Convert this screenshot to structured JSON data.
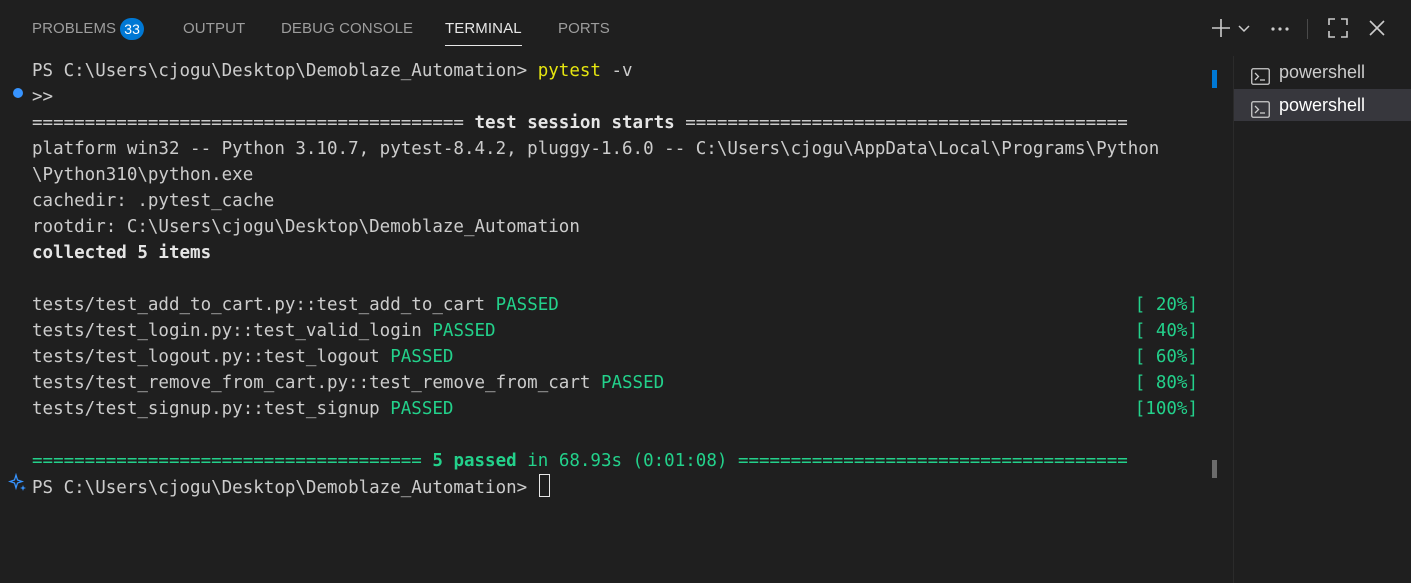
{
  "tabs": {
    "problems": "PROBLEMS",
    "problems_count": "33",
    "output": "OUTPUT",
    "debug_console": "DEBUG CONSOLE",
    "terminal": "TERMINAL",
    "ports": "PORTS"
  },
  "terminal": {
    "l1_prompt": "PS C:\\Users\\cjogu\\Desktop\\Demoblaze_Automation> ",
    "l1_cmd": "pytest",
    "l1_arg": " -v",
    "l2": ">>",
    "l3_left": "========================================= ",
    "l3_mid": "test session starts",
    "l3_right": " ==========================================",
    "l4": "platform win32 -- Python 3.10.7, pytest-8.4.2, pluggy-1.6.0 -- C:\\Users\\cjogu\\AppData\\Local\\Programs\\Python",
    "l5": "\\Python310\\python.exe",
    "l6": "cachedir: .pytest_cache",
    "l7": "rootdir: C:\\Users\\cjogu\\Desktop\\Demoblaze_Automation",
    "l8": "collected 5 items",
    "tests": [
      {
        "name": "tests/test_add_to_cart.py::test_add_to_cart ",
        "status": "PASSED",
        "pct": "[ 20%]"
      },
      {
        "name": "tests/test_login.py::test_valid_login ",
        "status": "PASSED",
        "pct": "[ 40%]"
      },
      {
        "name": "tests/test_logout.py::test_logout ",
        "status": "PASSED",
        "pct": "[ 60%]"
      },
      {
        "name": "tests/test_remove_from_cart.py::test_remove_from_cart ",
        "status": "PASSED",
        "pct": "[ 80%]"
      },
      {
        "name": "tests/test_signup.py::test_signup ",
        "status": "PASSED",
        "pct": "[100%]"
      }
    ],
    "summary_left": "===================================== ",
    "summary_passed": "5 passed",
    "summary_time": " in 68.93s (0:01:08) ",
    "summary_right": "=====================================",
    "final_prompt": "PS C:\\Users\\cjogu\\Desktop\\Demoblaze_Automation> "
  },
  "side": {
    "items": [
      {
        "label": "powershell"
      },
      {
        "label": "powershell"
      }
    ]
  }
}
